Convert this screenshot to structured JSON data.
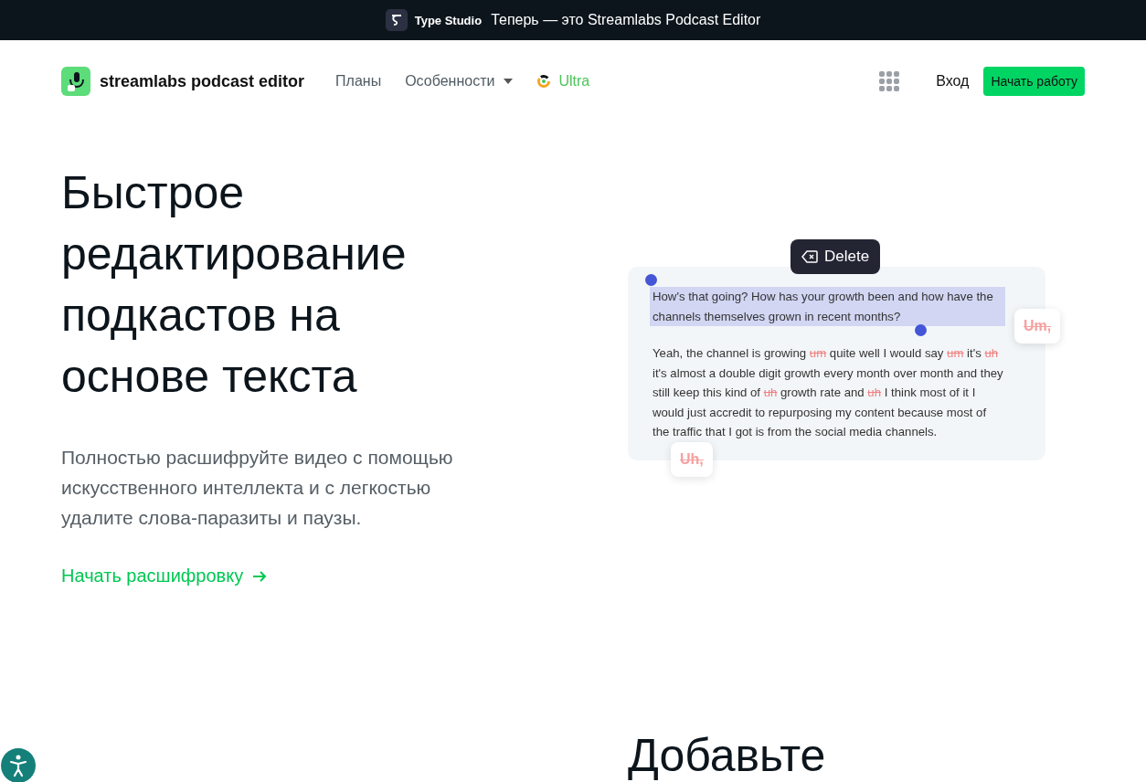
{
  "announcement": {
    "brand": "Type Studio",
    "text": "Теперь  — это Streamlabs Podcast Editor"
  },
  "nav": {
    "logo": "streamlabs podcast editor",
    "links": [
      {
        "label": "Планы",
        "kind": "link"
      },
      {
        "label": "Особенности",
        "kind": "dropdown"
      },
      {
        "label": "Ultra",
        "kind": "ultra"
      }
    ],
    "login": "Вход",
    "cta": "Начать работу"
  },
  "hero": {
    "title": "Быстрое редактирование подкастов на основе текста",
    "subtitle": "Полностью расшифруйте видео с помощью искусственного интеллекта и с легкостью удалите слова-паразиты и паузы.",
    "link": "Начать расшифровку"
  },
  "demo": {
    "delete_button": "Delete",
    "paragraphs": [
      {
        "selected": true,
        "segments": [
          {
            "text": "How's that going? How has your growth been and how have the channels themselves grown in recent months?",
            "filler": false
          }
        ]
      },
      {
        "selected": false,
        "segments": [
          {
            "text": "Yeah, the channel is growing ",
            "filler": false
          },
          {
            "text": "um",
            "filler": true
          },
          {
            "text": " quite well I would say ",
            "filler": false
          },
          {
            "text": "um",
            "filler": true
          },
          {
            "text": " it's ",
            "filler": false
          },
          {
            "text": "uh",
            "filler": true
          },
          {
            "text": " it's almost a double digit growth every month over month and they still keep this kind of ",
            "filler": false
          },
          {
            "text": "uh",
            "filler": true
          },
          {
            "text": " growth rate and ",
            "filler": false
          },
          {
            "text": "uh",
            "filler": true
          },
          {
            "text": " I think most of it I would just accredit to repurposing my content because most of the traffic that I got is from the social media channels.",
            "filler": false
          }
        ]
      }
    ],
    "chips": [
      "Um,",
      "Uh,"
    ]
  },
  "next_section": {
    "title": "Добавьте"
  }
}
